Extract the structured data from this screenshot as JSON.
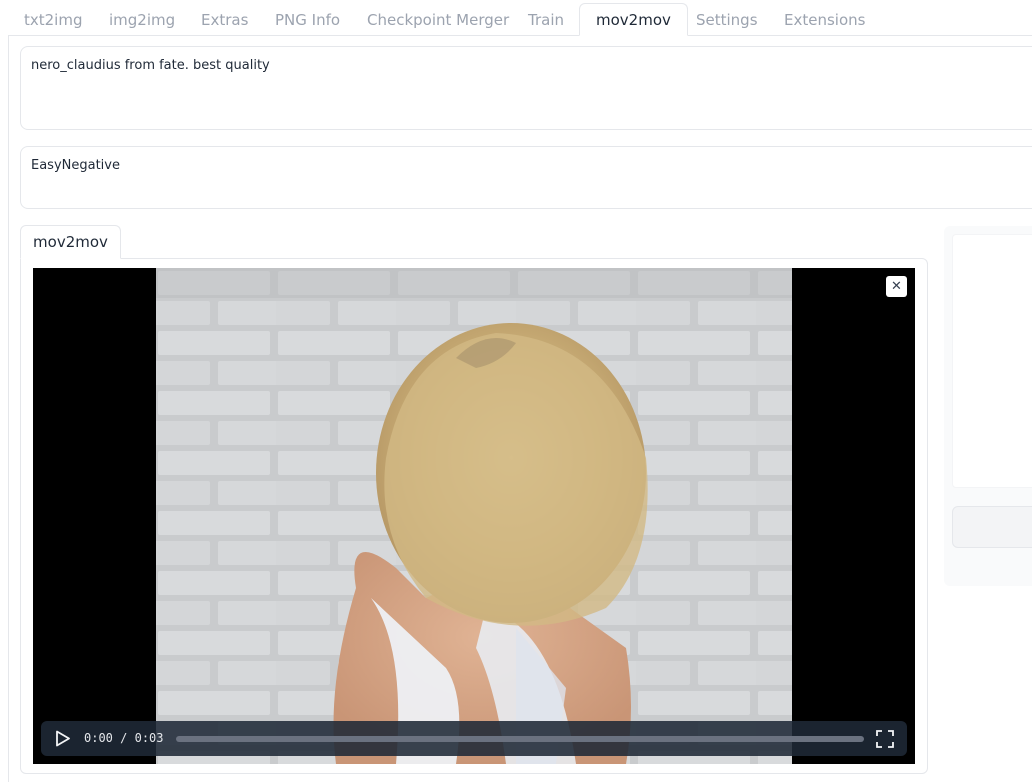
{
  "tabs": [
    {
      "label": "txt2img",
      "active": false
    },
    {
      "label": "img2img",
      "active": false
    },
    {
      "label": "Extras",
      "active": false
    },
    {
      "label": "PNG Info",
      "active": false
    },
    {
      "label": "Checkpoint Merger",
      "active": false
    },
    {
      "label": "Train",
      "active": false
    },
    {
      "label": "mov2mov",
      "active": true
    },
    {
      "label": "Settings",
      "active": false
    },
    {
      "label": "Extensions",
      "active": false
    }
  ],
  "prompt": {
    "positive": "nero_claudius from fate. best quality",
    "negative": "EasyNegative"
  },
  "mov2mov_tab": {
    "label": "mov2mov"
  },
  "video": {
    "current_time": "0:00",
    "separator": "/",
    "duration": "0:03",
    "progress": 0.0,
    "close_icon": "close-icon",
    "play_icon": "play-icon",
    "fullscreen_icon": "fullscreen-icon"
  },
  "colors": {
    "accent_text": "#1f2937",
    "inactive_tab": "#9ca3af",
    "border": "#e5e7eb",
    "control_bar": "#1f2937"
  }
}
